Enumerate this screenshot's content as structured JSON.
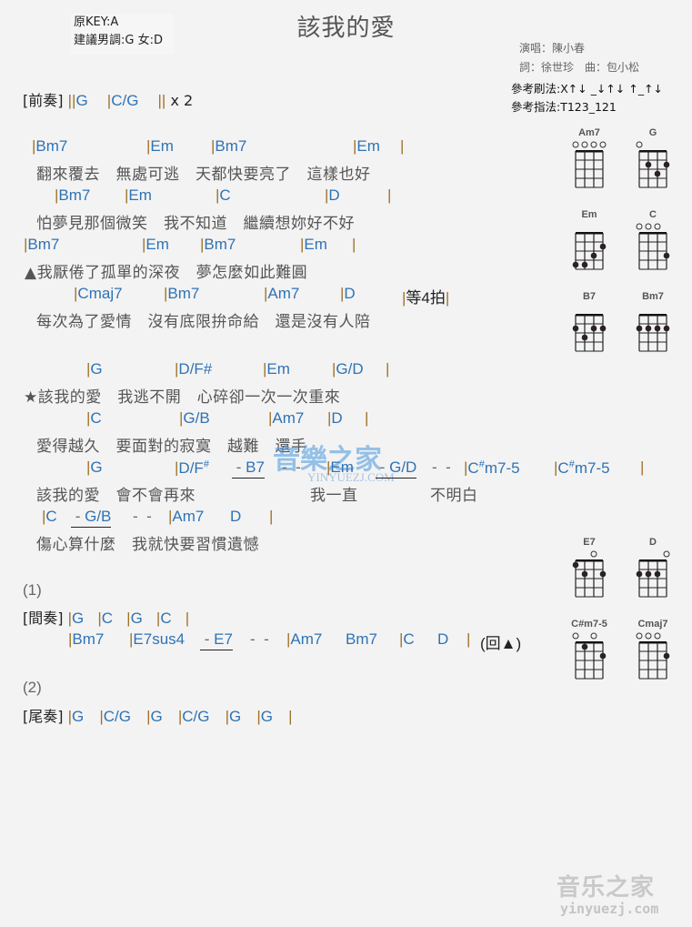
{
  "title": "該我的愛",
  "key_info": {
    "original_key": "原KEY:A",
    "suggested": "建議男調:G 女:D"
  },
  "credits": {
    "singer": "演唱：陳小春",
    "lyrics_music": "詞：徐世珍　曲：包小松"
  },
  "tips": {
    "strum": "參考刷法:X↑↓ _↓↑↓ ↑_↑↓",
    "pick": "參考指法:T123_121"
  },
  "intro": {
    "label": "[前奏]",
    "chords": [
      "G",
      "C/G"
    ],
    "repeat": "x 2"
  },
  "verse": [
    {
      "chords": [
        "Bm7",
        "Em",
        "Bm7",
        "Em"
      ],
      "lyric": "翻來覆去　無處可逃　天都快要亮了　這樣也好"
    },
    {
      "chords": [
        "Bm7",
        "Em",
        "C",
        "D"
      ],
      "lyric": "怕夢見那個微笑　我不知道　繼續想妳好不好"
    },
    {
      "chords": [
        "Bm7",
        "Em",
        "Bm7",
        "Em"
      ],
      "lyric": "▲我厭倦了孤單的深夜　夢怎麼如此難圓"
    },
    {
      "chords": [
        "Cmaj7",
        "Bm7",
        "Am7",
        "D"
      ],
      "extra": "等4拍",
      "lyric": "每次為了愛情　沒有底限拚命給　還是沒有人陪"
    }
  ],
  "chorus": [
    {
      "chords": [
        "G",
        "D/F#",
        "Em",
        "G/D"
      ],
      "lyric": "★該我的愛　我逃不開　心碎卻一次一次重來"
    },
    {
      "chords": [
        "C",
        "G/B",
        "Am7",
        "D"
      ],
      "lyric": "愛得越久　要面對的寂寞　越難　還手"
    },
    {
      "chords": [
        "G",
        "D/F#",
        "B7",
        "Em",
        "G/D",
        "C#m7-5",
        "C#m7-5"
      ],
      "lyric_parts": [
        "該我的愛　會不會再來",
        "我一直",
        "不明白"
      ]
    },
    {
      "chords": [
        "C",
        "G/B",
        "Am7",
        "D"
      ],
      "lyric": "傷心算什麼　我就快要習慣遺憾"
    }
  ],
  "ending1": {
    "marker": "(1)",
    "label": "[間奏]",
    "line1": [
      "G",
      "C",
      "G",
      "C"
    ],
    "line2": [
      "Bm7",
      "E7sus4",
      "E7",
      "Am7",
      "Bm7",
      "C",
      "D"
    ],
    "back": "(回▲)"
  },
  "ending2": {
    "marker": "(2)",
    "label": "[尾奏]",
    "chords": [
      "G",
      "C/G",
      "G",
      "C/G",
      "G",
      "G"
    ]
  },
  "dash": "-",
  "bar": "|",
  "double_bar": "||",
  "chord_diagrams": [
    {
      "name": "Am7",
      "open": [
        1,
        1,
        1,
        1
      ],
      "dots": []
    },
    {
      "name": "G",
      "open": [
        1,
        0,
        0,
        0
      ],
      "dots": [
        [
          2,
          2
        ],
        [
          4,
          2
        ],
        [
          3,
          3
        ]
      ]
    },
    {
      "name": "Em",
      "open": [
        0,
        0,
        0,
        0
      ],
      "dots": [
        [
          4,
          2
        ],
        [
          3,
          3
        ],
        [
          1,
          4
        ],
        [
          2,
          4
        ]
      ]
    },
    {
      "name": "C",
      "open": [
        1,
        1,
        1,
        0
      ],
      "dots": [
        [
          4,
          3
        ]
      ]
    },
    {
      "name": "B7",
      "open": [
        0,
        0,
        0,
        0
      ],
      "dots": [
        [
          1,
          2
        ],
        [
          3,
          2
        ],
        [
          4,
          2
        ],
        [
          2,
          3
        ]
      ]
    },
    {
      "name": "Bm7",
      "open": [
        0,
        0,
        0,
        0
      ],
      "dots": [
        [
          1,
          2
        ],
        [
          2,
          2
        ],
        [
          3,
          2
        ],
        [
          4,
          2
        ]
      ]
    },
    {
      "name": "E7",
      "open": [
        0,
        0,
        1,
        0
      ],
      "dots": [
        [
          1,
          1
        ],
        [
          2,
          2
        ],
        [
          4,
          2
        ]
      ]
    },
    {
      "name": "D",
      "open": [
        0,
        0,
        0,
        1
      ],
      "dots": [
        [
          1,
          2
        ],
        [
          2,
          2
        ],
        [
          3,
          2
        ]
      ]
    },
    {
      "name": "C#m7-5",
      "open": [
        1,
        0,
        1,
        0
      ],
      "dots": [
        [
          2,
          1
        ],
        [
          4,
          2
        ]
      ]
    },
    {
      "name": "Cmaj7",
      "open": [
        1,
        1,
        1,
        0
      ],
      "dots": [
        [
          4,
          2
        ]
      ]
    }
  ],
  "watermarks": {
    "center": "音樂之家",
    "center_sub": "YINYUEZJ.COM",
    "corner": "音乐之家",
    "corner_sub": "yinyuezj.com"
  }
}
